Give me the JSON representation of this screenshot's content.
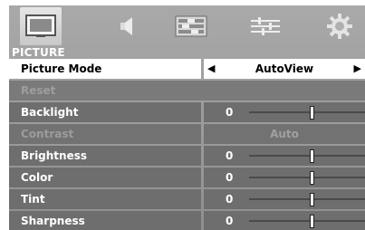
{
  "menu": {
    "tabs": [
      {
        "name": "picture-icon",
        "active": true
      },
      {
        "name": "sound-icon",
        "active": false
      },
      {
        "name": "setup-icon",
        "active": false
      },
      {
        "name": "adjust-icon",
        "active": false
      },
      {
        "name": "options-icon",
        "active": false
      }
    ],
    "section_title": "PICTURE"
  },
  "rows": {
    "picture_mode": {
      "label": "Picture Mode",
      "value": "AutoView",
      "left_arrow": "◀",
      "right_arrow": "▶"
    },
    "reset": {
      "label": "Reset"
    },
    "backlight": {
      "label": "Backlight",
      "value": "0",
      "level": 0.54
    },
    "contrast": {
      "label": "Contrast",
      "value": "Auto"
    },
    "brightness": {
      "label": "Brightness",
      "value": "0",
      "level": 0.54
    },
    "color": {
      "label": "Color",
      "value": "0",
      "level": 0.54
    },
    "tint": {
      "label": "Tint",
      "value": "0",
      "level": 0.54
    },
    "sharpness": {
      "label": "Sharpness",
      "value": "0",
      "level": 0.54
    }
  },
  "colors": {
    "panel": "#9d9d9d",
    "row_bg": "#6e6e6e",
    "selected_bg": "#ffffff",
    "disabled_text": "#9c9c9c"
  }
}
